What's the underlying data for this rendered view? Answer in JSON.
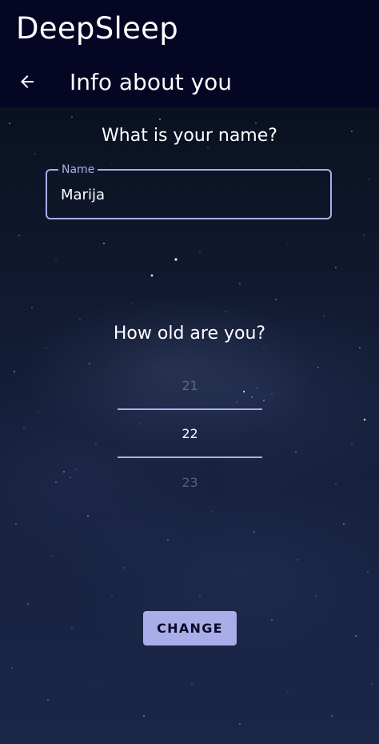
{
  "appbar": {
    "title": "DeepSleep",
    "page_title": "Info about you",
    "back_icon": "arrow-left-icon"
  },
  "name_section": {
    "question": "What is your name?",
    "field_label": "Name",
    "field_value": "Marija"
  },
  "age_section": {
    "question": "How old are you?",
    "previous": "21",
    "selected": "22",
    "next": "23"
  },
  "actions": {
    "change_label": "CHANGE"
  },
  "colors": {
    "appbar_bg": "#050524",
    "accent": "#a9aee8",
    "text": "#ffffff"
  }
}
